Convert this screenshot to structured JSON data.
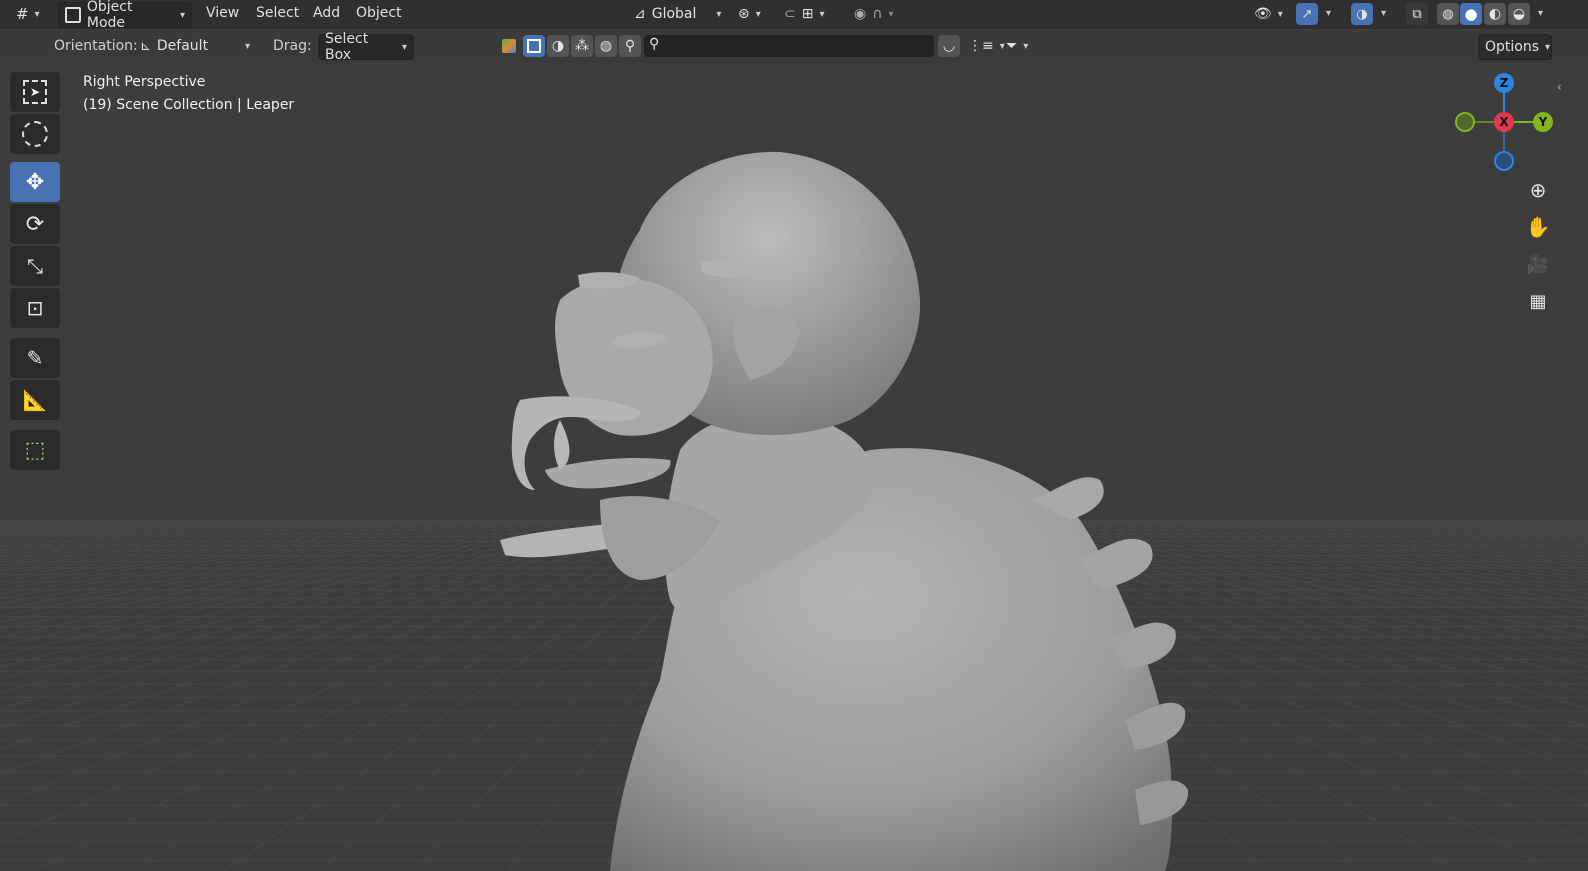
{
  "header": {
    "mode": "Object Mode",
    "menus": [
      "View",
      "Select",
      "Add",
      "Object"
    ],
    "transform_orientation": "Global",
    "options_label": "Options"
  },
  "tool_header": {
    "orientation_label": "Orientation:",
    "orientation_value": "Default",
    "drag_label": "Drag:",
    "drag_value": "Select Box",
    "search_placeholder": ""
  },
  "viewport": {
    "view_name": "Right Perspective",
    "collection_info": "(19) Scene Collection | Leaper"
  },
  "gizmo": {
    "z": "Z",
    "x": "X",
    "y": "Y"
  },
  "colors": {
    "accent": "#4772b3",
    "axis_x": "#e5364f",
    "axis_y": "#83b521",
    "axis_z": "#2f84e0"
  },
  "toolbar": [
    "select-box-icon",
    "cursor-icon",
    "move-icon",
    "rotate-icon",
    "scale-icon",
    "transform-icon",
    "annotate-icon",
    "measure-icon",
    "add-cube-icon"
  ],
  "nav_icons": [
    "zoom-icon",
    "pan-hand-icon",
    "camera-icon",
    "ortho-grid-icon"
  ]
}
